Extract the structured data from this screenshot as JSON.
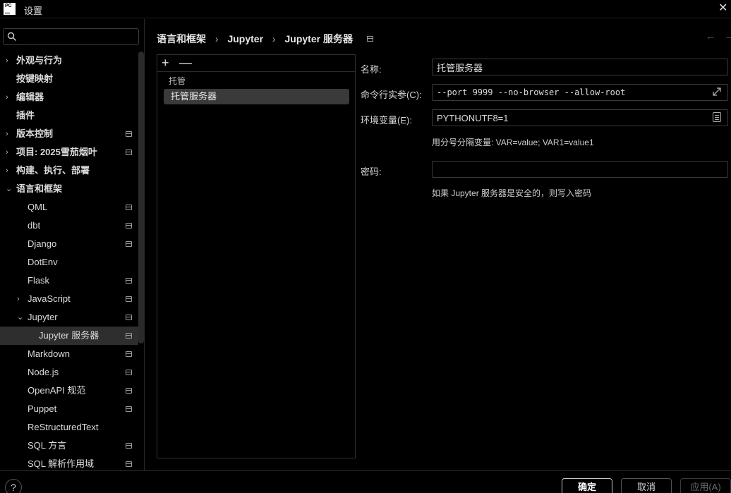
{
  "window": {
    "title": "设置",
    "logo_text": "PC"
  },
  "search": {
    "placeholder": "",
    "value": ""
  },
  "sidebar": {
    "items": [
      {
        "label": "外观与行为",
        "arrow": "›",
        "bold": true,
        "indent": 0,
        "proj": false,
        "selected": false
      },
      {
        "label": "按键映射",
        "arrow": "",
        "bold": true,
        "indent": 0,
        "proj": false,
        "selected": false
      },
      {
        "label": "编辑器",
        "arrow": "›",
        "bold": true,
        "indent": 0,
        "proj": false,
        "selected": false
      },
      {
        "label": "插件",
        "arrow": "",
        "bold": true,
        "indent": 0,
        "proj": false,
        "selected": false
      },
      {
        "label": "版本控制",
        "arrow": "›",
        "bold": true,
        "indent": 0,
        "proj": true,
        "selected": false
      },
      {
        "label": "项目: 2025雪茄烟叶",
        "arrow": "›",
        "bold": true,
        "indent": 0,
        "proj": true,
        "selected": false
      },
      {
        "label": "构建、执行、部署",
        "arrow": "›",
        "bold": true,
        "indent": 0,
        "proj": false,
        "selected": false
      },
      {
        "label": "语言和框架",
        "arrow": "⌄",
        "bold": true,
        "indent": 0,
        "proj": false,
        "selected": false
      },
      {
        "label": "QML",
        "arrow": "",
        "bold": false,
        "indent": 1,
        "proj": true,
        "selected": false
      },
      {
        "label": "dbt",
        "arrow": "",
        "bold": false,
        "indent": 1,
        "proj": true,
        "selected": false
      },
      {
        "label": "Django",
        "arrow": "",
        "bold": false,
        "indent": 1,
        "proj": true,
        "selected": false
      },
      {
        "label": "DotEnv",
        "arrow": "",
        "bold": false,
        "indent": 1,
        "proj": false,
        "selected": false
      },
      {
        "label": "Flask",
        "arrow": "",
        "bold": false,
        "indent": 1,
        "proj": true,
        "selected": false
      },
      {
        "label": "JavaScript",
        "arrow": "›",
        "bold": false,
        "indent": 1,
        "proj": true,
        "selected": false
      },
      {
        "label": "Jupyter",
        "arrow": "⌄",
        "bold": false,
        "indent": 1,
        "proj": true,
        "selected": false
      },
      {
        "label": "Jupyter 服务器",
        "arrow": "",
        "bold": false,
        "indent": 2,
        "proj": true,
        "selected": true
      },
      {
        "label": "Markdown",
        "arrow": "",
        "bold": false,
        "indent": 1,
        "proj": true,
        "selected": false
      },
      {
        "label": "Node.js",
        "arrow": "",
        "bold": false,
        "indent": 1,
        "proj": true,
        "selected": false
      },
      {
        "label": "OpenAPI 规范",
        "arrow": "",
        "bold": false,
        "indent": 1,
        "proj": true,
        "selected": false
      },
      {
        "label": "Puppet",
        "arrow": "",
        "bold": false,
        "indent": 1,
        "proj": true,
        "selected": false
      },
      {
        "label": "ReStructuredText",
        "arrow": "",
        "bold": false,
        "indent": 1,
        "proj": false,
        "selected": false
      },
      {
        "label": "SQL 方言",
        "arrow": "",
        "bold": false,
        "indent": 1,
        "proj": true,
        "selected": false
      },
      {
        "label": "SQL 解析作用域",
        "arrow": "",
        "bold": false,
        "indent": 1,
        "proj": true,
        "selected": false
      }
    ]
  },
  "breadcrumb": {
    "items": [
      "语言和框架",
      "Jupyter",
      "Jupyter 服务器"
    ],
    "separator": "›"
  },
  "nav": {
    "back": "←",
    "forward": "→"
  },
  "server_list": {
    "add_label": "+",
    "remove_label": "—",
    "group": "托管",
    "selected_server": "托管服务器"
  },
  "form": {
    "name_label": "名称:",
    "name_value": "托管服务器",
    "cmd_label": "命令行实参(C):",
    "cmd_value": "--port 9999 --no-browser --allow-root",
    "env_label": "环境变量(E):",
    "env_value": "PYTHONUTF8=1",
    "env_hint": "用分号分隔变量: VAR=value; VAR1=value1",
    "password_label": "密码:",
    "password_value": "",
    "password_hint": "如果 Jupyter 服务器是安全的，则写入密码"
  },
  "footer": {
    "help": "?",
    "ok": "确定",
    "cancel": "取消",
    "apply": "应用(A)"
  }
}
